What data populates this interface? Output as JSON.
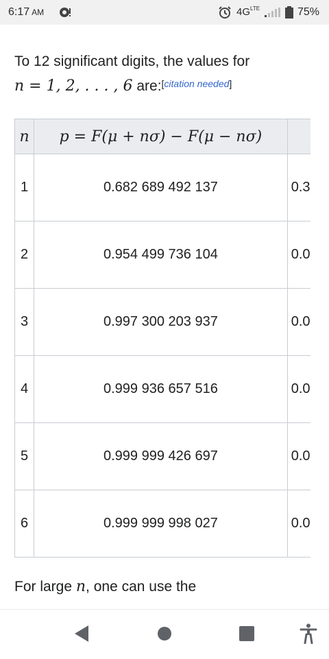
{
  "status_bar": {
    "time": "6:17",
    "ampm": "AM",
    "network": "4G",
    "network_sup": "LTE",
    "battery": "75%"
  },
  "article": {
    "intro_text": "To 12 significant digits, the values for",
    "intro_math": "n = 1, 2, . . . , 6",
    "intro_after": "are:",
    "citation": "citation needed",
    "table": {
      "header_n": "n",
      "header_p": "p = F(μ + nσ) − F(μ − nσ)",
      "rows": [
        {
          "n": "1",
          "p": "0.682 689 492 137",
          "q": "0.3"
        },
        {
          "n": "2",
          "p": "0.954 499 736 104",
          "q": "0.0"
        },
        {
          "n": "3",
          "p": "0.997 300 203 937",
          "q": "0.0"
        },
        {
          "n": "4",
          "p": "0.999 936 657 516",
          "q": "0.0"
        },
        {
          "n": "5",
          "p": "0.999 999 426 697",
          "q": "0.0"
        },
        {
          "n": "6",
          "p": "0.999 999 998 027",
          "q": "0.0"
        }
      ]
    },
    "outro_text": "For large",
    "outro_math": "n",
    "outro_after": ", one can use the"
  },
  "icons": {
    "notification": "notification-icon",
    "alarm": "alarm-icon",
    "signal": "signal-icon",
    "battery": "battery-icon",
    "back": "back-icon",
    "home": "home-icon",
    "recent": "recent-apps-icon",
    "accessibility": "accessibility-icon"
  },
  "colors": {
    "link": "#3366cc",
    "table_header_bg": "#eaecf0",
    "table_border": "#c8ccd1",
    "status_bar_bg": "#f1f1f1",
    "nav_icon": "#5f6368"
  }
}
